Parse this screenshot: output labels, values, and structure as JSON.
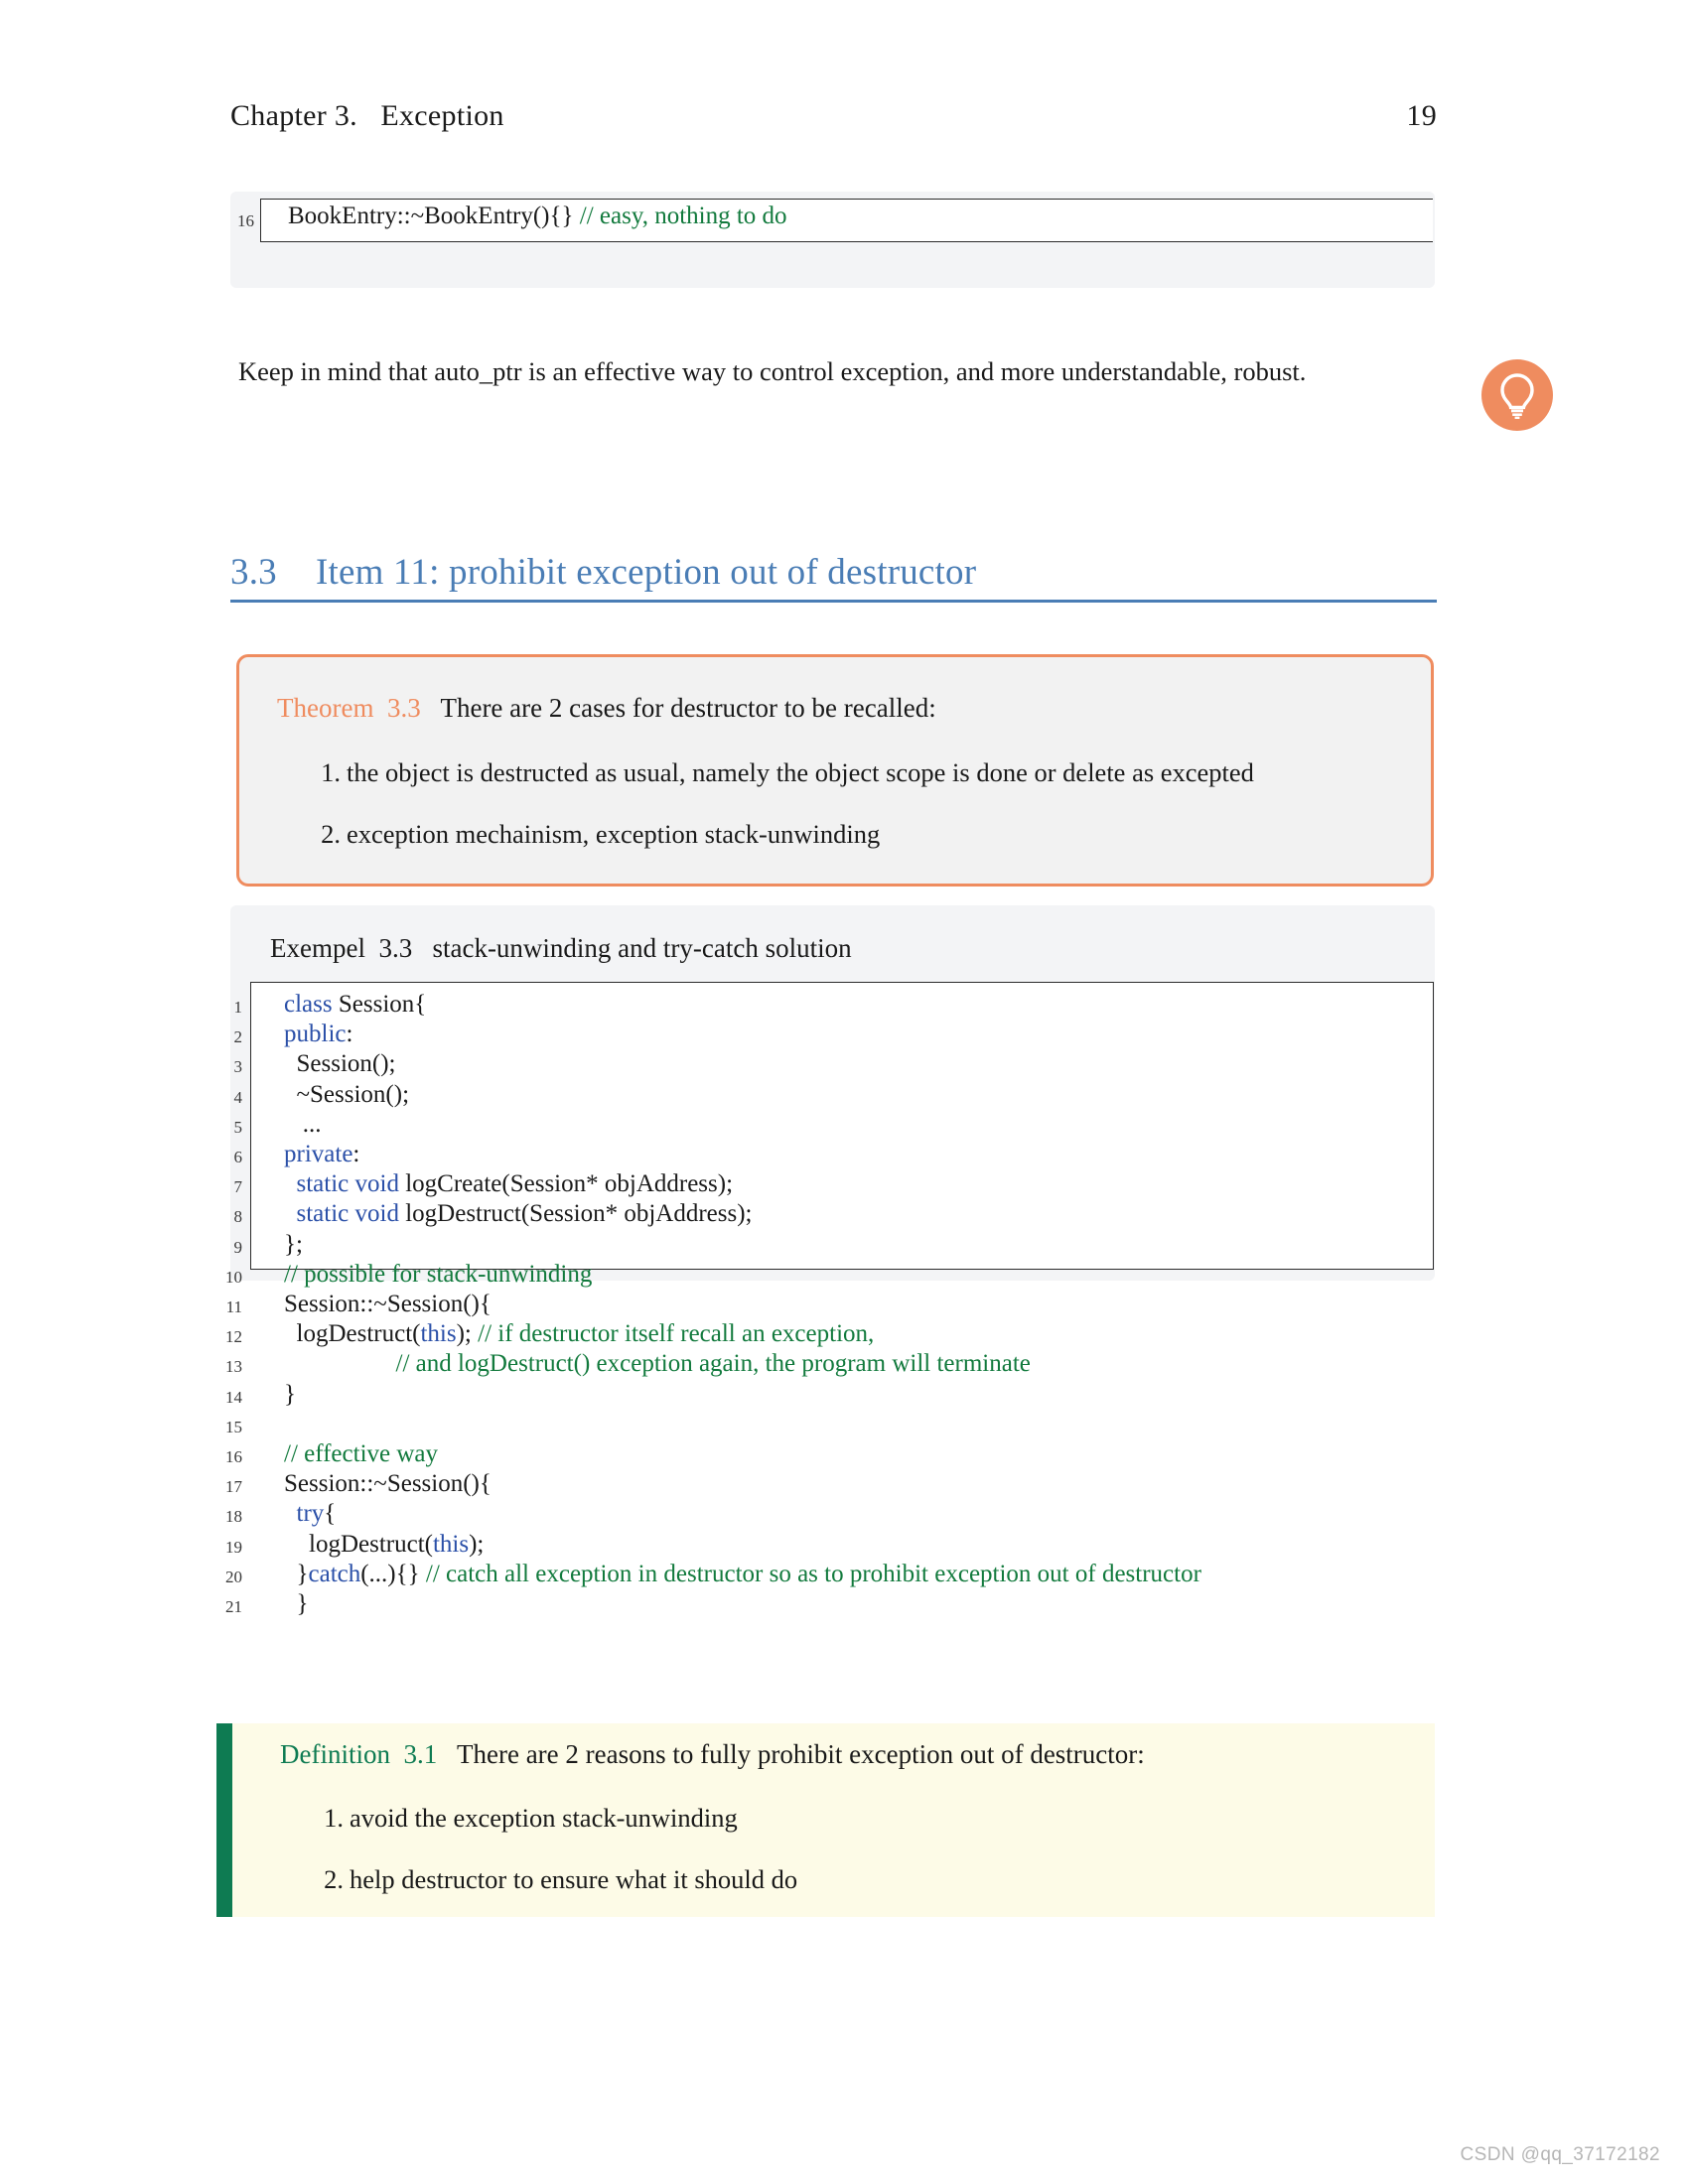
{
  "header": {
    "chapter": "Chapter 3.   Exception",
    "page_number": "19"
  },
  "top_snippet": {
    "line_number": "16",
    "code_plain": "BookEntry::~BookEntry(){} ",
    "code_comment": "// easy, nothing to do"
  },
  "paragraph": "Keep in mind that auto_ptr is an effective way to control exception, and more understandable, robust.",
  "bulb_icon": "lightbulb-icon",
  "section": {
    "number": "3.3",
    "title": "Item 11: prohibit exception out of destructor"
  },
  "theorem": {
    "label": "Theorem  3.3",
    "statement": "   There are 2 cases for destructor to be recalled:",
    "items": [
      {
        "marker": "1.",
        "text": "the object is destructed as usual, namely the object scope is done or delete as excepted"
      },
      {
        "marker": "2.",
        "text": "exception mechainism, exception stack-unwinding"
      }
    ]
  },
  "example": {
    "caption": "Exempel  3.3   stack-unwinding and try-catch solution",
    "line_numbers": [
      "1",
      "2",
      "3",
      "4",
      "5",
      "6",
      "7",
      "8",
      "9",
      "10",
      "11",
      "12",
      "13",
      "14",
      "15",
      "16",
      "17",
      "18",
      "19",
      "20",
      "21"
    ],
    "lines": [
      [
        {
          "t": "kw",
          "s": "class "
        },
        {
          "t": "pl",
          "s": "Session{"
        }
      ],
      [
        {
          "t": "kw",
          "s": "public"
        },
        {
          "t": "pl",
          "s": ":"
        }
      ],
      [
        {
          "t": "pl",
          "s": "  Session();"
        }
      ],
      [
        {
          "t": "pl",
          "s": "  ~Session();"
        }
      ],
      [
        {
          "t": "pl",
          "s": "   ..."
        }
      ],
      [
        {
          "t": "kw",
          "s": "private"
        },
        {
          "t": "pl",
          "s": ":"
        }
      ],
      [
        {
          "t": "pl",
          "s": "  "
        },
        {
          "t": "kw",
          "s": "static void "
        },
        {
          "t": "pl",
          "s": "logCreate(Session* objAddress);"
        }
      ],
      [
        {
          "t": "pl",
          "s": "  "
        },
        {
          "t": "kw",
          "s": "static void "
        },
        {
          "t": "pl",
          "s": "logDestruct(Session* objAddress);"
        }
      ],
      [
        {
          "t": "pl",
          "s": "};"
        }
      ],
      [
        {
          "t": "cm",
          "s": "// possible for stack-unwinding"
        }
      ],
      [
        {
          "t": "pl",
          "s": "Session::~Session(){"
        }
      ],
      [
        {
          "t": "pl",
          "s": "  logDestruct("
        },
        {
          "t": "kw",
          "s": "this"
        },
        {
          "t": "pl",
          "s": "); "
        },
        {
          "t": "cm",
          "s": "// if destructor itself recall an exception,"
        }
      ],
      [
        {
          "t": "cm",
          "s": "                  // and logDestruct() exception again, the program will terminate"
        }
      ],
      [
        {
          "t": "pl",
          "s": "}"
        }
      ],
      [
        {
          "t": "pl",
          "s": ""
        }
      ],
      [
        {
          "t": "cm",
          "s": "// effective way"
        }
      ],
      [
        {
          "t": "pl",
          "s": "Session::~Session(){"
        }
      ],
      [
        {
          "t": "kw",
          "s": "  try"
        },
        {
          "t": "pl",
          "s": "{"
        }
      ],
      [
        {
          "t": "pl",
          "s": "    logDestruct("
        },
        {
          "t": "kw",
          "s": "this"
        },
        {
          "t": "pl",
          "s": ");"
        }
      ],
      [
        {
          "t": "pl",
          "s": "  }"
        },
        {
          "t": "kw",
          "s": "catch"
        },
        {
          "t": "pl",
          "s": "(...){} "
        },
        {
          "t": "cm",
          "s": "// catch all exception in destructor so as to prohibit exception out of destructor"
        }
      ],
      [
        {
          "t": "pl",
          "s": "  }"
        }
      ]
    ]
  },
  "definition": {
    "label": "Definition  3.1",
    "statement": "   There are 2 reasons to fully prohibit exception out of destructor:",
    "items": [
      {
        "marker": "1.",
        "text": "avoid the exception stack-unwinding"
      },
      {
        "marker": "2.",
        "text": "help destructor to ensure what it should do"
      }
    ]
  },
  "watermark": "CSDN @qq_37172182",
  "colors": {
    "accent_orange": "#ef8c5f",
    "heading_blue": "#4a7db5",
    "keyword_blue": "#2b50a8",
    "comment_green": "#127a3d",
    "definition_green": "#0e7b52",
    "definition_bg": "#fdfbe7",
    "panel_grey": "#f3f4f6",
    "theorem_bg": "#f2f2f2"
  }
}
